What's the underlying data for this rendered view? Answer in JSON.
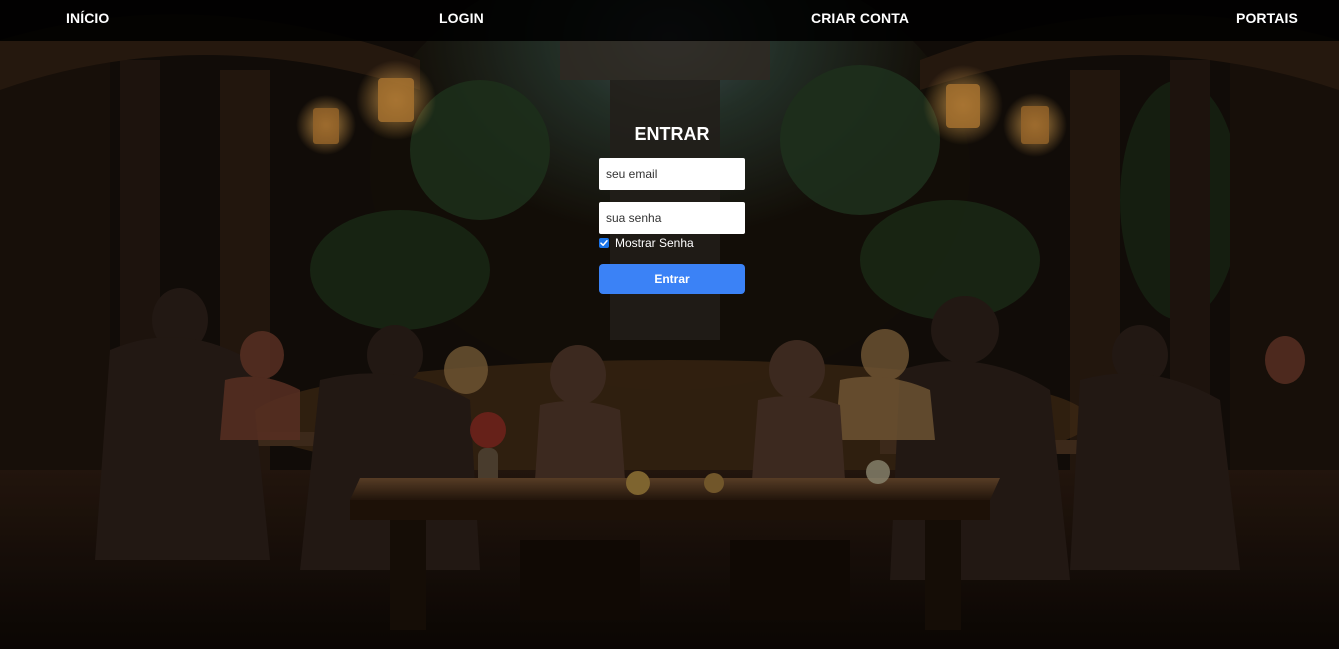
{
  "nav": {
    "home": "INÍCIO",
    "login": "LOGIN",
    "signup": "CRIAR CONTA",
    "portals": "PORTAIS"
  },
  "login_form": {
    "title": "ENTRAR",
    "email_placeholder": "seu email",
    "password_placeholder": "sua senha",
    "show_password_label": "Mostrar Senha",
    "show_password_checked": true,
    "submit_label": "Entrar"
  },
  "colors": {
    "navbar_bg": "#000000",
    "submit_button": "#3b82f6",
    "checkbox_accent": "#1a73e8",
    "text": "#ffffff"
  }
}
